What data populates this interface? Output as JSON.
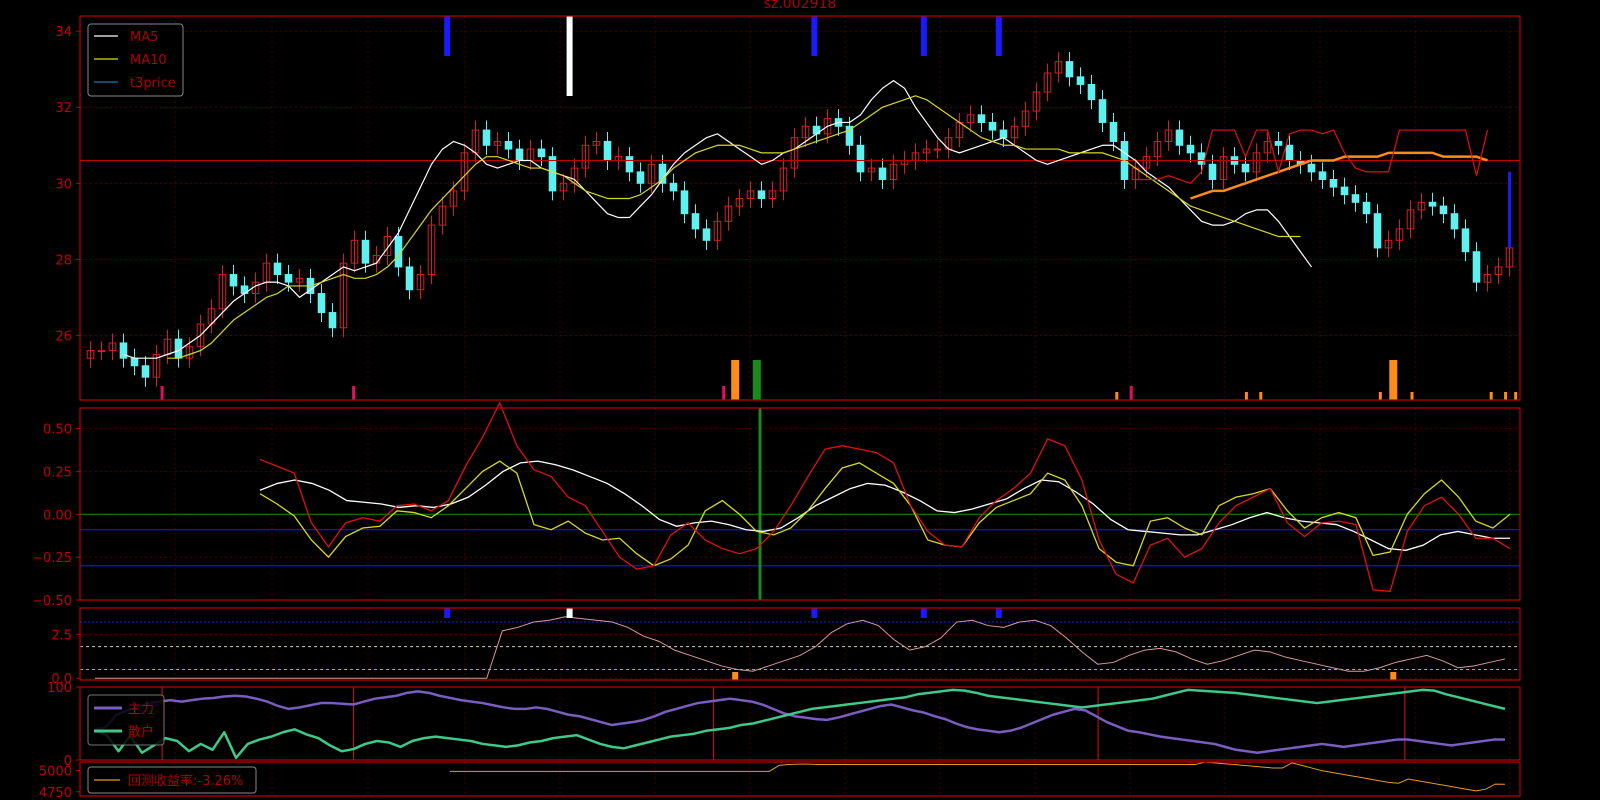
{
  "title": "sz.002918",
  "colors": {
    "background": "#000000",
    "frame": "#c00000",
    "grid": "#6a0000",
    "up": "#d02020",
    "down": "#5ff0f0",
    "ma5": "#ffffff",
    "ma10": "#d8d820",
    "t3price": "#1f77b4",
    "zhuli": "#7b5cc0",
    "sanhu": "#3ec98a",
    "backtest": "#e89a20",
    "orange": "#ff8c1a",
    "legend_text": "#b00000"
  },
  "chart_data": [
    {
      "type": "candlestick",
      "panel": "price",
      "title": "sz.002918",
      "ylim": [
        24.3,
        34.4
      ],
      "y_ticks": [
        "26",
        "28",
        "30",
        "32",
        "34"
      ],
      "legend": [
        "MA5",
        "MA10",
        "t3price"
      ],
      "legend_position": "top-left",
      "grid": true,
      "closes": [
        25.6,
        25.6,
        25.8,
        25.4,
        25.2,
        24.9,
        25.5,
        25.9,
        25.4,
        25.7,
        26.3,
        26.7,
        27.6,
        27.3,
        27.1,
        27.4,
        27.9,
        27.6,
        27.4,
        27.5,
        27.1,
        26.6,
        26.2,
        27.9,
        28.5,
        27.9,
        28.1,
        28.6,
        27.8,
        27.2,
        27.6,
        28.9,
        29.4,
        29.8,
        30.8,
        31.4,
        31.0,
        31.1,
        30.9,
        30.6,
        30.9,
        30.7,
        29.8,
        30.0,
        30.4,
        31.0,
        31.1,
        30.6,
        30.7,
        30.3,
        30.0,
        30.5,
        30.0,
        29.8,
        29.2,
        28.8,
        28.5,
        29.0,
        29.4,
        29.6,
        29.8,
        29.6,
        29.8,
        30.4,
        31.2,
        31.5,
        31.3,
        31.7,
        31.5,
        31.0,
        30.3,
        30.4,
        30.1,
        30.5,
        30.6,
        30.8,
        30.9,
        30.9,
        31.2,
        31.6,
        31.8,
        31.6,
        31.4,
        31.2,
        31.5,
        31.9,
        32.4,
        32.9,
        33.2,
        32.8,
        32.6,
        32.2,
        31.6,
        31.1,
        30.1,
        30.4,
        30.7,
        31.1,
        31.4,
        31.0,
        30.8,
        30.5,
        30.1,
        30.7,
        30.5,
        30.3,
        30.8,
        31.1,
        31.0,
        30.6,
        30.5,
        30.3,
        30.1,
        29.9,
        29.7,
        29.5,
        29.2,
        28.3,
        28.5,
        28.8,
        29.3,
        29.5,
        29.4,
        29.2,
        28.8,
        28.2,
        27.4,
        27.6,
        27.8,
        28.3
      ],
      "ma5": [
        25.5,
        25.4,
        25.4,
        25.4,
        25.5,
        25.6,
        25.8,
        26.0,
        26.3,
        26.6,
        26.9,
        27.1,
        27.3,
        27.4,
        27.4,
        27.3,
        27.0,
        27.2,
        27.4,
        27.6,
        27.8,
        27.7,
        27.8,
        27.9,
        28.3,
        28.7,
        29.3,
        29.9,
        30.5,
        30.9,
        31.1,
        31.0,
        30.8,
        30.5,
        30.4,
        30.5,
        30.6,
        30.6,
        30.4,
        30.3,
        30.2,
        30.1,
        29.8,
        29.5,
        29.2,
        29.1,
        29.1,
        29.4,
        29.7,
        30.1,
        30.5,
        30.8,
        31.0,
        31.2,
        31.3,
        31.1,
        30.9,
        30.7,
        30.5,
        30.6,
        30.8,
        30.9,
        31.1,
        31.3,
        31.5,
        31.6,
        31.6,
        31.8,
        32.2,
        32.5,
        32.7,
        32.5,
        32.0,
        31.6,
        31.2,
        30.9,
        30.8,
        30.9,
        31.0,
        31.1,
        31.2,
        31.0,
        30.8,
        30.6,
        30.5,
        30.6,
        30.7,
        30.8,
        30.9,
        31.0,
        31.0,
        30.8,
        30.6,
        30.3,
        30.1,
        29.9,
        29.6,
        29.3,
        29.0,
        28.9,
        28.9,
        29.0,
        29.2,
        29.3,
        29.3,
        29.0,
        28.6,
        28.2,
        27.8
      ],
      "ma10": [
        25.4,
        25.4,
        25.5,
        25.6,
        25.8,
        26.1,
        26.4,
        26.6,
        26.8,
        27.0,
        27.1,
        27.3,
        27.3,
        27.3,
        27.4,
        27.5,
        27.6,
        27.5,
        27.5,
        27.6,
        27.8,
        28.1,
        28.5,
        28.9,
        29.3,
        29.6,
        29.9,
        30.2,
        30.5,
        30.7,
        30.7,
        30.6,
        30.5,
        30.4,
        30.4,
        30.3,
        30.2,
        30.0,
        29.8,
        29.7,
        29.6,
        29.6,
        29.6,
        29.7,
        29.9,
        30.1,
        30.4,
        30.6,
        30.8,
        30.9,
        31.0,
        31.0,
        31.0,
        30.9,
        30.8,
        30.8,
        30.8,
        30.9,
        31.0,
        31.1,
        31.2,
        31.3,
        31.4,
        31.6,
        31.8,
        32.0,
        32.1,
        32.2,
        32.3,
        32.2,
        32.0,
        31.8,
        31.6,
        31.4,
        31.2,
        31.1,
        31.0,
        31.0,
        30.9,
        30.9,
        30.9,
        30.9,
        30.8,
        30.8,
        30.8,
        30.8,
        30.7,
        30.6,
        30.4,
        30.2,
        30.0,
        29.8,
        29.6,
        29.4,
        29.3,
        29.2,
        29.1,
        29.0,
        28.9,
        28.8,
        28.7,
        28.6,
        28.6,
        28.6
      ],
      "orange_curve": [
        29.6,
        29.7,
        29.8,
        29.8,
        29.9,
        30.0,
        30.1,
        30.2,
        30.3,
        30.4,
        30.5,
        30.6,
        30.6,
        30.6,
        30.7,
        30.7,
        30.7,
        30.7,
        30.8,
        30.8,
        30.8,
        30.8,
        30.8,
        30.7,
        30.7,
        30.7,
        30.7,
        30.6
      ],
      "red_step": [
        30.1,
        30.1,
        30.1,
        30.2,
        30.1,
        30.0,
        30.3,
        31.4,
        31.4,
        31.4,
        30.7,
        31.4,
        31.4,
        30.3,
        31.3,
        31.4,
        31.4,
        31.3,
        31.4,
        30.8,
        30.4,
        30.3,
        30.3,
        30.3,
        31.4,
        31.4,
        31.4,
        31.4,
        31.4,
        31.4,
        31.4,
        30.2,
        31.4
      ],
      "reference_price": 30.6
    },
    {
      "type": "line",
      "panel": "oscillator",
      "ylim": [
        -0.5,
        0.62
      ],
      "y_ticks": [
        "0.50",
        "0.25",
        "0.00",
        "−0.25",
        "−0.50"
      ],
      "hlines": [
        0.0,
        -0.09,
        -0.3
      ],
      "series": [
        {
          "color": "#ffffff",
          "values": [
            0.14,
            0.18,
            0.2,
            0.18,
            0.14,
            0.08,
            0.07,
            0.06,
            0.04,
            0.05,
            0.04,
            0.06,
            0.1,
            0.17,
            0.25,
            0.3,
            0.31,
            0.29,
            0.26,
            0.22,
            0.18,
            0.12,
            0.05,
            -0.03,
            -0.07,
            -0.05,
            -0.04,
            -0.06,
            -0.09,
            -0.1,
            -0.08,
            -0.02,
            0.05,
            0.1,
            0.15,
            0.18,
            0.17,
            0.13,
            0.08,
            0.02,
            0.01,
            0.03,
            0.06,
            0.09,
            0.15,
            0.2,
            0.19,
            0.13,
            0.06,
            -0.03,
            -0.09,
            -0.1,
            -0.11,
            -0.12,
            -0.12,
            -0.09,
            -0.06,
            -0.02,
            0.01,
            -0.02,
            -0.04,
            -0.05,
            -0.06,
            -0.1,
            -0.15,
            -0.2,
            -0.21,
            -0.18,
            -0.12,
            -0.1,
            -0.12,
            -0.14,
            -0.14
          ]
        },
        {
          "color": "#d8d820",
          "values": [
            0.12,
            0.06,
            -0.01,
            -0.15,
            -0.25,
            -0.13,
            -0.08,
            -0.07,
            0.02,
            0.01,
            -0.02,
            0.05,
            0.15,
            0.25,
            0.31,
            0.24,
            -0.06,
            -0.09,
            -0.04,
            -0.11,
            -0.15,
            -0.14,
            -0.23,
            -0.3,
            -0.26,
            -0.18,
            0.02,
            0.08,
            0.0,
            -0.1,
            -0.12,
            -0.08,
            0.02,
            0.15,
            0.27,
            0.3,
            0.24,
            0.18,
            0.05,
            -0.15,
            -0.18,
            -0.19,
            -0.05,
            0.04,
            0.08,
            0.12,
            0.24,
            0.2,
            0.05,
            -0.2,
            -0.28,
            -0.3,
            -0.04,
            -0.02,
            -0.08,
            -0.12,
            0.05,
            0.1,
            0.12,
            0.15,
            0.02,
            -0.08,
            -0.02,
            0.01,
            -0.02,
            -0.24,
            -0.22,
            0.0,
            0.12,
            0.2,
            0.1,
            -0.04,
            -0.08,
            0.0
          ]
        },
        {
          "color": "#e01010",
          "values": [
            0.32,
            0.28,
            0.24,
            -0.05,
            -0.19,
            -0.05,
            -0.02,
            -0.04,
            0.05,
            0.06,
            0.02,
            0.08,
            0.28,
            0.45,
            0.65,
            0.4,
            0.26,
            0.22,
            0.1,
            0.05,
            -0.1,
            -0.25,
            -0.32,
            -0.3,
            -0.12,
            -0.05,
            -0.15,
            -0.2,
            -0.23,
            -0.2,
            -0.1,
            0.05,
            0.22,
            0.38,
            0.4,
            0.38,
            0.36,
            0.3,
            0.05,
            -0.1,
            -0.18,
            -0.19,
            -0.02,
            0.08,
            0.15,
            0.24,
            0.44,
            0.4,
            0.2,
            -0.15,
            -0.35,
            -0.4,
            -0.18,
            -0.14,
            -0.25,
            -0.2,
            -0.05,
            0.05,
            0.1,
            0.15,
            -0.05,
            -0.13,
            -0.05,
            -0.04,
            -0.06,
            -0.44,
            -0.45,
            -0.1,
            0.05,
            0.1,
            0.0,
            -0.14,
            -0.14,
            -0.2
          ]
        }
      ],
      "green_marker": true
    },
    {
      "type": "line",
      "panel": "indicator",
      "ylim": [
        -0.1,
        4.0
      ],
      "y_ticks": [
        "2.5",
        "0.0"
      ],
      "hlines": [
        3.2,
        1.8,
        0.5
      ],
      "series": [
        {
          "color": "#d89a9a",
          "values": [
            0.0,
            0.0,
            0.0,
            0.0,
            0.0,
            0.0,
            0.0,
            0.0,
            0.0,
            0.0,
            0.0,
            0.0,
            0.0,
            0.0,
            0.0,
            0.0,
            0.0,
            0.0,
            0.0,
            0.0,
            0.0,
            0.0,
            0.0,
            0.0,
            0.0,
            0.0,
            2.7,
            2.9,
            3.2,
            3.3,
            3.5,
            3.4,
            3.3,
            3.2,
            2.9,
            2.4,
            2.1,
            1.6,
            1.3,
            1.0,
            0.7,
            0.5,
            0.4,
            0.7,
            1.0,
            1.3,
            1.8,
            2.6,
            3.1,
            3.3,
            3.0,
            2.2,
            1.6,
            1.8,
            2.3,
            3.2,
            3.3,
            3.0,
            2.9,
            3.2,
            3.3,
            3.0,
            2.3,
            1.5,
            0.8,
            0.9,
            1.3,
            1.6,
            1.7,
            1.5,
            1.1,
            0.8,
            1.0,
            1.3,
            1.6,
            1.5,
            1.2,
            1.0,
            0.8,
            0.6,
            0.4,
            0.4,
            0.6,
            0.9,
            1.1,
            1.3,
            1.0,
            0.6,
            0.7,
            0.9,
            1.1
          ]
        }
      ]
    },
    {
      "type": "line",
      "panel": "flows",
      "ylim": [
        0,
        100
      ],
      "y_ticks": [
        "100",
        "0"
      ],
      "legend": [
        "主力",
        "散户"
      ],
      "legend_position": "top-left",
      "series": [
        {
          "name": "主力",
          "values": [
            42,
            45,
            62,
            68,
            73,
            78,
            80,
            82,
            80,
            82,
            84,
            85,
            87,
            88,
            87,
            84,
            80,
            74,
            70,
            72,
            75,
            78,
            78,
            77,
            76,
            80,
            84,
            86,
            88,
            92,
            94,
            92,
            88,
            85,
            82,
            80,
            78,
            75,
            72,
            70,
            70,
            72,
            70,
            66,
            62,
            60,
            56,
            52,
            48,
            50,
            52,
            55,
            60,
            66,
            70,
            74,
            78,
            80,
            82,
            84,
            82,
            80,
            76,
            70,
            64,
            60,
            58,
            56,
            55,
            58,
            62,
            66,
            70,
            74,
            76,
            72,
            68,
            65,
            60,
            56,
            50,
            45,
            42,
            40,
            38,
            40,
            44,
            50,
            56,
            62,
            66,
            70,
            68,
            60,
            52,
            46,
            40,
            38,
            35,
            32,
            30,
            28,
            26,
            24,
            22,
            18,
            14,
            12,
            10,
            12,
            14,
            16,
            18,
            20,
            22,
            20,
            18,
            20,
            22,
            24,
            26,
            28,
            28,
            26,
            24,
            22,
            20,
            22,
            24,
            26,
            28,
            28
          ]
        },
        {
          "name": "散户",
          "values": [
            40,
            34,
            12,
            33,
            10,
            20,
            30,
            26,
            12,
            22,
            14,
            38,
            3,
            22,
            28,
            32,
            38,
            42,
            35,
            30,
            20,
            12,
            15,
            22,
            26,
            24,
            18,
            26,
            30,
            32,
            30,
            28,
            26,
            22,
            20,
            18,
            20,
            24,
            26,
            30,
            32,
            34,
            28,
            22,
            18,
            16,
            20,
            24,
            28,
            32,
            34,
            36,
            40,
            42,
            44,
            48,
            50,
            54,
            58,
            62,
            66,
            70,
            72,
            74,
            76,
            78,
            80,
            82,
            84,
            86,
            90,
            92,
            94,
            96,
            95,
            92,
            88,
            86,
            84,
            82,
            80,
            78,
            76,
            74,
            72,
            74,
            76,
            78,
            80,
            82,
            84,
            88,
            92,
            96,
            95,
            94,
            93,
            92,
            90,
            88,
            86,
            84,
            82,
            80,
            78,
            80,
            82,
            84,
            86,
            88,
            90,
            92,
            94,
            96,
            95,
            90,
            86,
            82,
            78,
            74,
            70
          ]
        }
      ],
      "red_vlines": true
    },
    {
      "type": "line",
      "panel": "backtest",
      "ylim": [
        4700,
        5100
      ],
      "y_ticks": [
        "5000",
        "4750"
      ],
      "legend": [
        "回测收益率:-3.26%"
      ],
      "legend_position": "left",
      "series": [
        {
          "name": "回测收益率:-3.26%",
          "values": [
            4990,
            4990,
            4990,
            4990,
            4990,
            4990,
            4990,
            4990,
            4990,
            4990,
            4990,
            4990,
            4990,
            4990,
            4990,
            4990,
            4990,
            4990,
            4990,
            4990,
            4990,
            4990,
            4990,
            4990,
            4990,
            4990,
            4990,
            4990,
            4990,
            4990,
            4990,
            4990,
            4990,
            4990,
            5060,
            5070,
            5075,
            5075,
            5070,
            5070,
            5070,
            5070,
            5070,
            5070,
            5070,
            5070,
            5070,
            5070,
            5070,
            5070,
            5070,
            5070,
            5070,
            5070,
            5070,
            5070,
            5070,
            5070,
            5070,
            5070,
            5070,
            5070,
            5070,
            5070,
            5070,
            5070,
            5070,
            5070,
            5070,
            5070,
            5070,
            5070,
            5070,
            5070,
            5070,
            5070,
            5070,
            5070,
            5100,
            5090,
            5080,
            5070,
            5060,
            5050,
            5040,
            5030,
            5030,
            5090,
            5060,
            5030,
            5000,
            4980,
            4960,
            4940,
            4920,
            4900,
            4880,
            4860,
            4850,
            4900,
            4880,
            4860,
            4840,
            4820,
            4800,
            4780,
            4760,
            4780,
            4840,
            4838
          ]
        }
      ]
    }
  ]
}
